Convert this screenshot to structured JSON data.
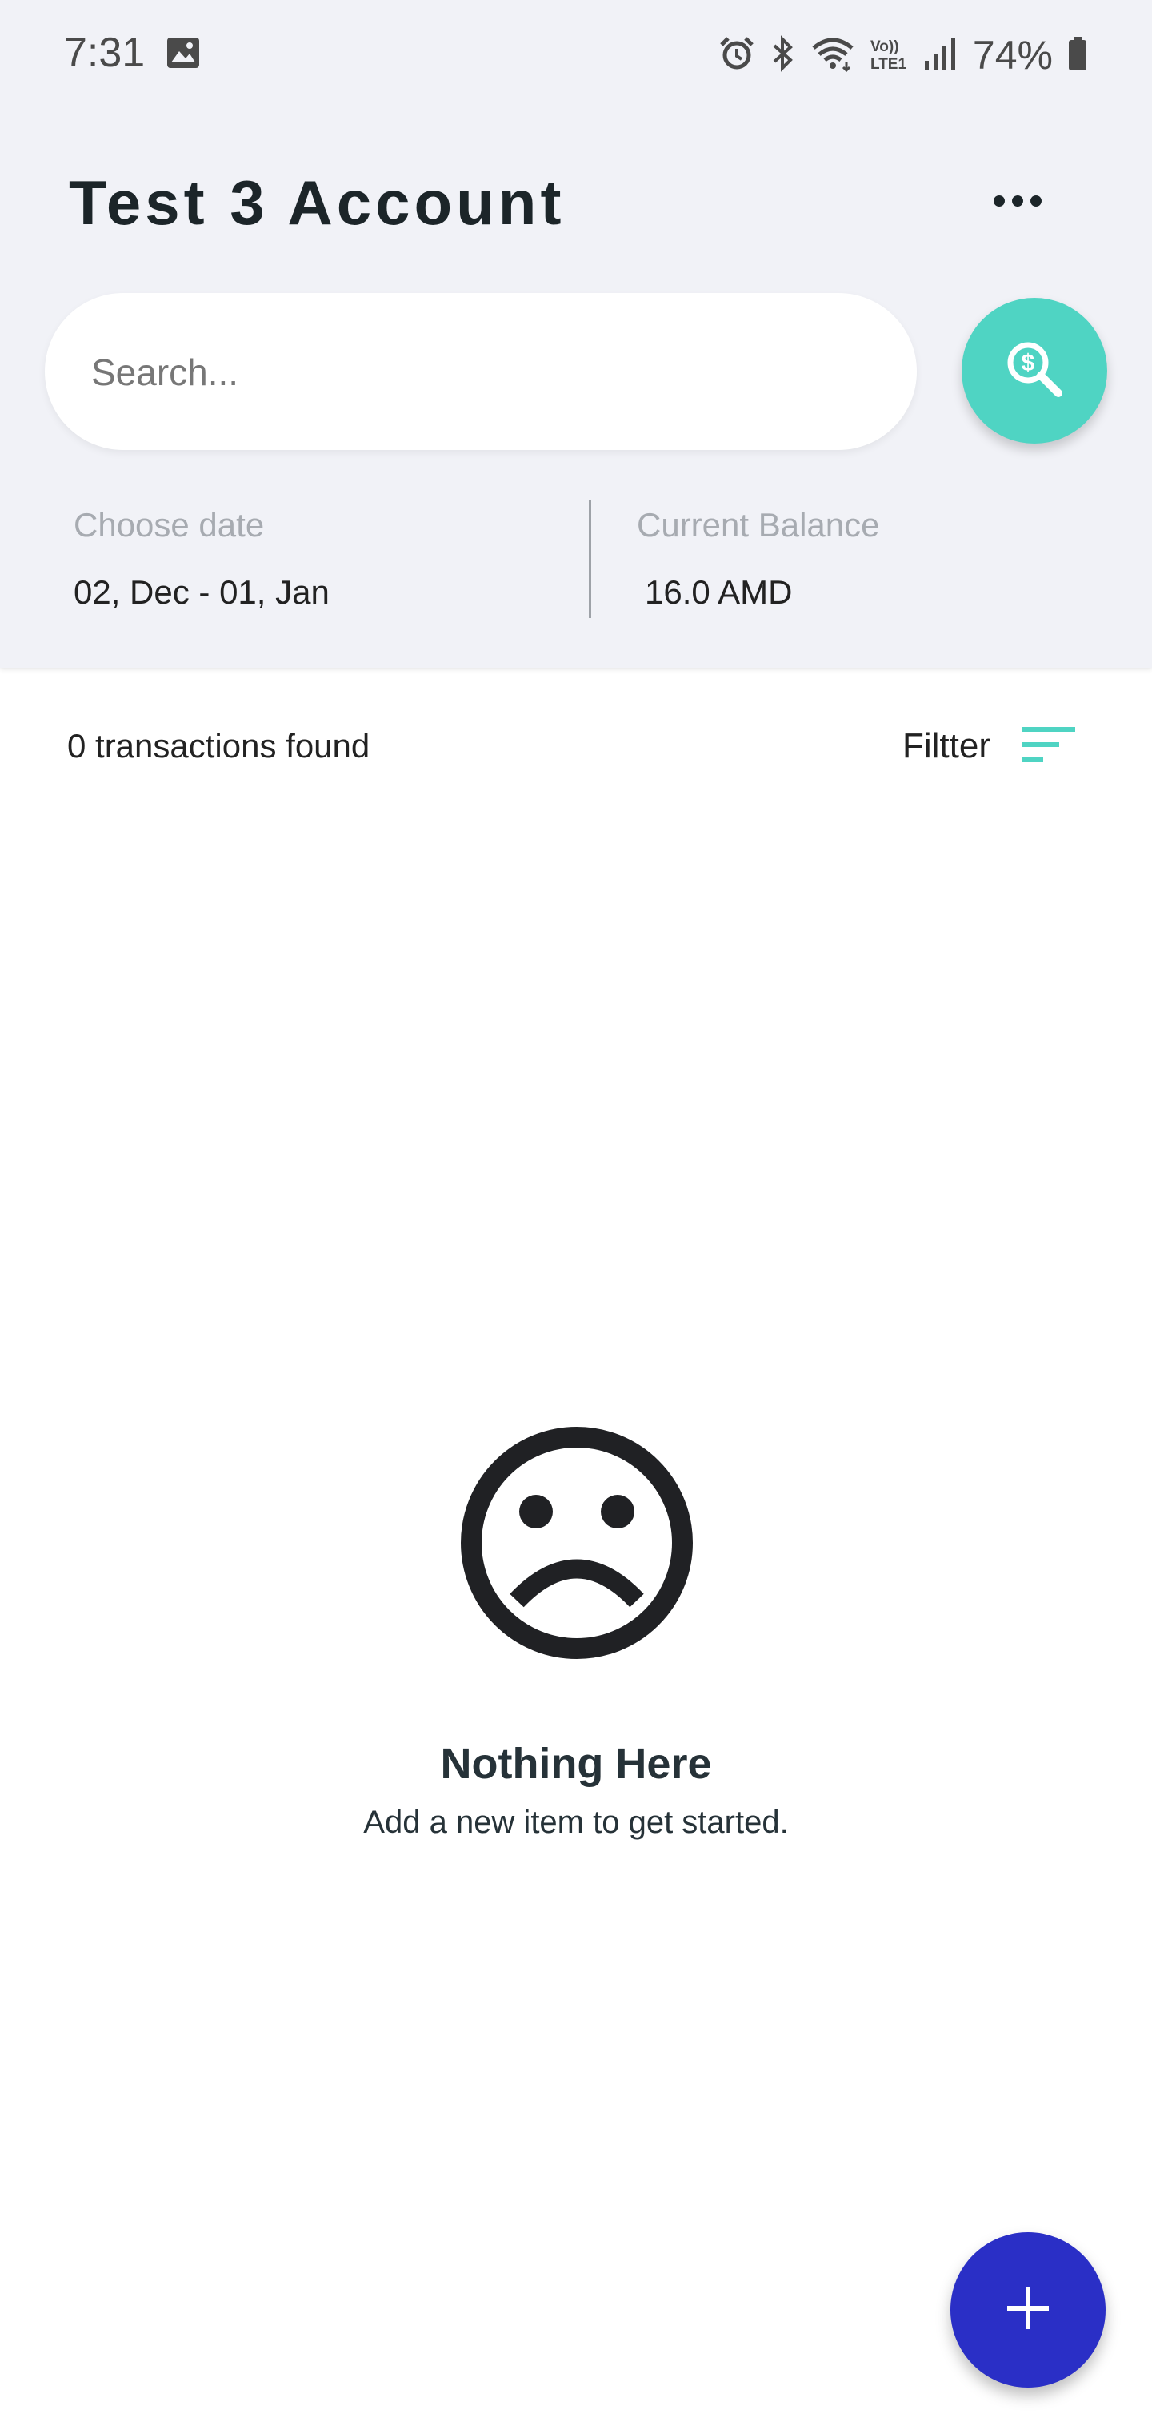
{
  "status_bar": {
    "time": "7:31",
    "battery": "74%",
    "icons": [
      "image-icon",
      "alarm-icon",
      "bluetooth-icon",
      "wifi-icon",
      "volte-icon",
      "signal-icon",
      "battery-icon"
    ]
  },
  "header": {
    "title": "Test 3 Account",
    "menu_icon": "more-horizontal-icon"
  },
  "search": {
    "placeholder": "Search...",
    "value": "",
    "button_icon": "search-dollar-icon"
  },
  "summary": {
    "date_label": "Choose date",
    "date_value": "02, Dec - 01, Jan",
    "balance_label": "Current Balance",
    "balance_value": "16.0 AMD"
  },
  "list": {
    "count_text": "0 transactions found",
    "filter_label": "Filtter",
    "filter_icon": "filter-lines-icon"
  },
  "empty_state": {
    "icon": "sad-face-icon",
    "title": "Nothing Here",
    "subtitle": "Add a new item to get started."
  },
  "fab": {
    "icon": "plus-icon"
  },
  "colors": {
    "header_bg": "#f1f2f7",
    "accent_teal": "#4fd4c3",
    "fab_blue": "#2a2fc6",
    "title_text": "#1c2529"
  }
}
